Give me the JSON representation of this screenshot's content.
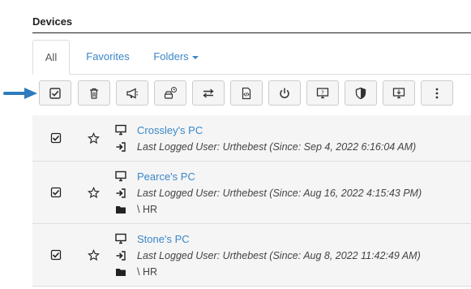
{
  "section": {
    "title": "Devices"
  },
  "tabs": [
    {
      "label": "All",
      "active": true
    },
    {
      "label": "Favorites",
      "active": false
    },
    {
      "label": "Folders",
      "active": false
    }
  ],
  "toolbar": {
    "buttons": [
      {
        "icon": "checkbox-icon"
      },
      {
        "icon": "trash-icon"
      },
      {
        "icon": "megaphone-icon"
      },
      {
        "icon": "scheduled-drive-icon"
      },
      {
        "icon": "transfer-icon"
      },
      {
        "icon": "script-icon"
      },
      {
        "icon": "power-icon"
      },
      {
        "icon": "monitor-help-icon"
      },
      {
        "icon": "shield-icon"
      },
      {
        "icon": "download-install-icon"
      },
      {
        "icon": "more-vertical-icon"
      }
    ]
  },
  "devices": [
    {
      "name": "Crossley's PC",
      "last_logged": "Last Logged User: Urthebest (Since: Sep 4, 2022 6:16:04 AM)",
      "folder": ""
    },
    {
      "name": "Pearce's PC",
      "last_logged": "Last Logged User: Urthebest (Since: Aug 16, 2022 4:15:43 PM)",
      "folder": "\\ HR"
    },
    {
      "name": "Stone's PC",
      "last_logged": "Last Logged User: Urthebest (Since: Aug 8, 2022 11:42:49 AM)",
      "folder": "\\ HR"
    }
  ],
  "colors": {
    "link": "#3a87c8",
    "arrow": "#2e7bbd",
    "row_bg": "#f5f5f5"
  }
}
